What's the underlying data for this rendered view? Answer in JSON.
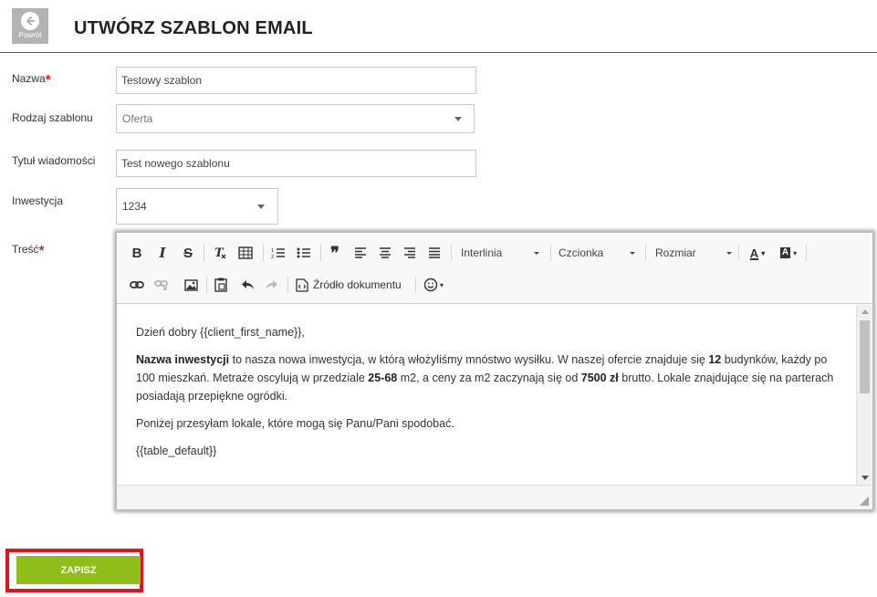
{
  "header": {
    "back_label": "Powrót",
    "title": "UTWÓRZ SZABLON EMAIL"
  },
  "form": {
    "name": {
      "label": "Nazwa",
      "value": "Testowy szablon",
      "required": true
    },
    "template_type": {
      "label": "Rodzaj szablonu",
      "value": "Oferta"
    },
    "subject": {
      "label": "Tytuł wiadomości",
      "value": "Test nowego szablonu"
    },
    "investment": {
      "label": "Inwestycja",
      "value": "1234"
    },
    "body": {
      "label": "Treść",
      "required": true
    }
  },
  "editor": {
    "toolbar": {
      "bold": "B",
      "italic": "I",
      "strike": "S",
      "quote": "❞",
      "line_height": "Interlinia",
      "font": "Czcionka",
      "size": "Rozmiar",
      "text_color": "A",
      "bg_color": "A",
      "source": "Źródło dokumentu"
    },
    "content": {
      "greeting": "Dzień dobry {{client_first_name}},",
      "p2_b1": "Nazwa inwestycji",
      "p2_t1": " to nasza nowa inwestycja, w którą włożyliśmy mnóstwo wysiłku. W naszej ofercie znajduje się ",
      "p2_b2": "12",
      "p2_t2": " budynków, każdy po 100 mieszkań. Metraże oscylują w przedziale ",
      "p2_b3": "25-68",
      "p2_t3": " m2, a ceny za m2 zaczynają się od ",
      "p2_b4": "7500 zł",
      "p2_t4": " brutto. Lokale znajdujące się na parterach posiadają przepiękne ogródki.",
      "p3": "Poniżej przesyłam lokale, które mogą się Panu/Pani spodobać.",
      "p4": "{{table_default}}"
    }
  },
  "actions": {
    "save": "ZAPISZ"
  },
  "colors": {
    "save_green": "#8fbe1a",
    "highlight_red": "#e0141e",
    "required_red": "#e2231a",
    "title_rule": "#3a6290"
  }
}
